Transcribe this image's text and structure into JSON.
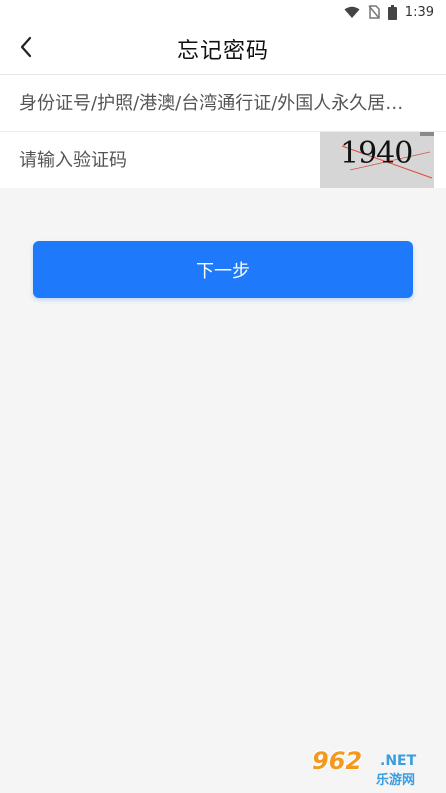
{
  "status_bar": {
    "time": "1:39",
    "icons": [
      "wifi-icon",
      "no-sim-icon",
      "battery-icon"
    ]
  },
  "header": {
    "title": "忘记密码",
    "back_icon": "chevron-left-icon"
  },
  "form": {
    "id_field": {
      "placeholder": "身份证号/护照/港澳/台湾通行证/外国人永久居留身份证",
      "value": ""
    },
    "captcha_field": {
      "placeholder": "请输入验证码",
      "value": ""
    },
    "captcha_image_text": "1940"
  },
  "actions": {
    "next_label": "下一步"
  },
  "watermark": {
    "main": "962",
    "net": ".NET",
    "sub": "乐游网"
  },
  "colors": {
    "primary": "#1e7afb",
    "background": "#f5f5f5",
    "surface": "#ffffff"
  }
}
